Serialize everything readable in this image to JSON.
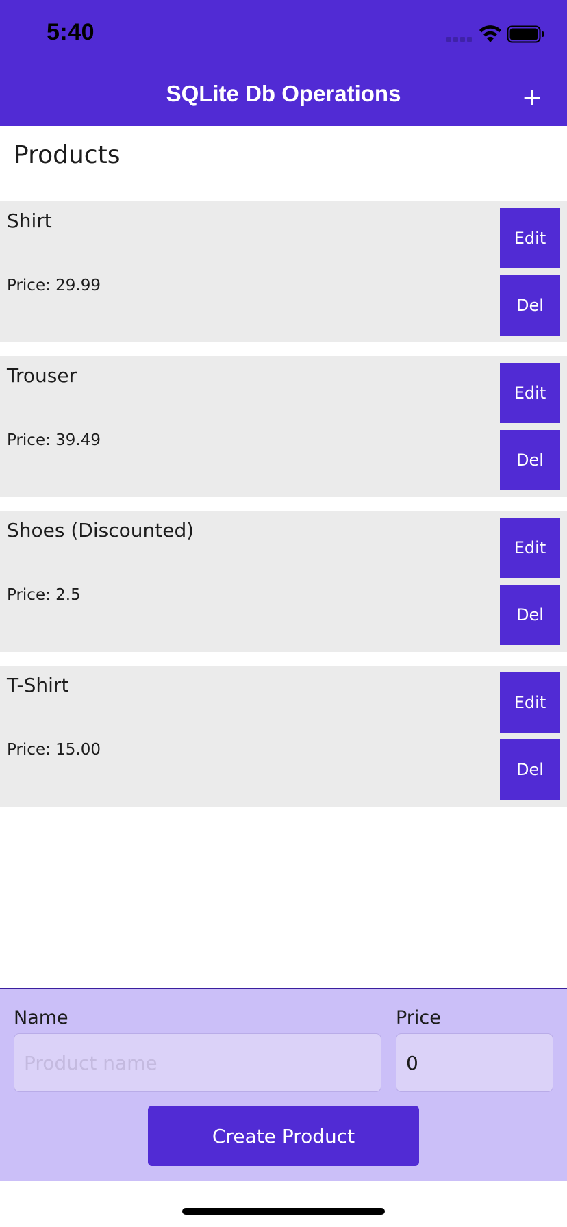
{
  "status_bar": {
    "time": "5:40",
    "icons": [
      "cellular-signal-icon",
      "wifi-icon",
      "battery-icon"
    ]
  },
  "header": {
    "title": "SQLite Db Operations",
    "add_label": "+"
  },
  "page": {
    "title": "Products"
  },
  "products": [
    {
      "name": "Shirt",
      "price": "Price: 29.99",
      "edit_label": "Edit",
      "del_label": "Del"
    },
    {
      "name": "Trouser",
      "price": "Price: 39.49",
      "edit_label": "Edit",
      "del_label": "Del"
    },
    {
      "name": "Shoes (Discounted)",
      "price": "Price: 2.5",
      "edit_label": "Edit",
      "del_label": "Del"
    },
    {
      "name": "T-Shirt",
      "price": "Price: 15.00",
      "edit_label": "Edit",
      "del_label": "Del"
    }
  ],
  "form": {
    "name_label": "Name",
    "name_value": "",
    "name_placeholder": "Product name",
    "price_label": "Price",
    "price_value": "0",
    "create_label": "Create Product"
  },
  "colors": {
    "accent": "#512bd4",
    "row_background": "#ebebeb",
    "form_background": "#cbbff8",
    "input_background": "#dbd2f8"
  }
}
